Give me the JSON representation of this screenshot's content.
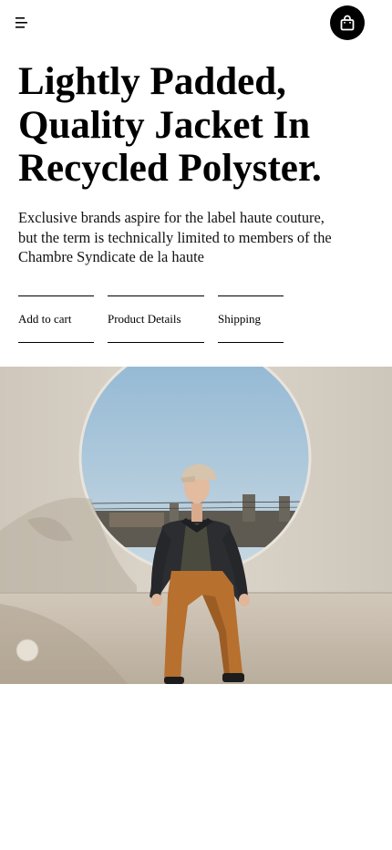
{
  "header": {
    "menu_icon": "menu-icon",
    "bag_icon": "shopping-bag-icon"
  },
  "product": {
    "headline": "Lightly Padded, Quality Jacket In Recycled Polyster.",
    "description": "Exclusive brands aspire for the label haute couture, but the term is technically limited to members of the Chambre Syndicate de la haute"
  },
  "actions": {
    "add_to_cart": "Add to cart",
    "product_details": "Product Details",
    "shipping": "Shipping"
  },
  "colors": {
    "accent": "#000000",
    "background": "#ffffff",
    "sky": "#a9c7dc",
    "wall": "#d8d0c4",
    "pants": "#b8702e",
    "jacket": "#2b2d31"
  }
}
